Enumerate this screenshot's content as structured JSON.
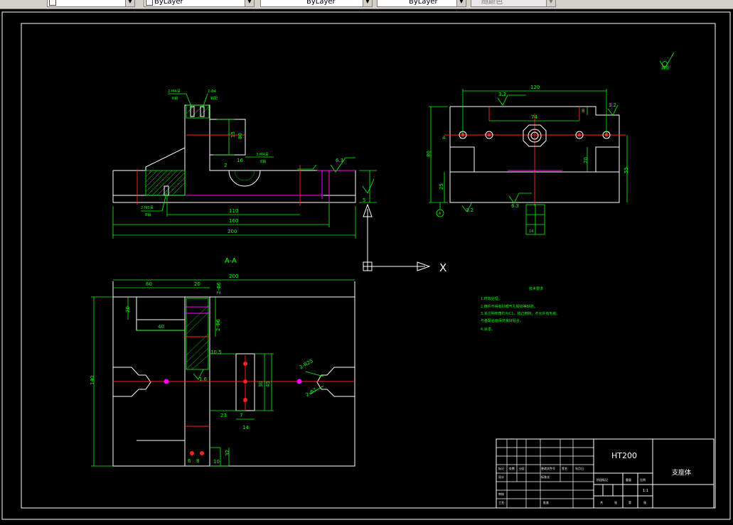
{
  "toolbar": {
    "layer_value": "",
    "color_value": "ByLayer",
    "linetype_value": "ByLayer",
    "lineweight_value": "ByLayer",
    "plotstyle_value": "随颜色"
  },
  "drawing": {
    "section_label": "A-A",
    "ucs_x_label": "X",
    "top_view_dims": {
      "d15": "15",
      "d80": "80",
      "d16": "16",
      "d2": "2",
      "d63": "6.3",
      "d110": "110",
      "d160": "160",
      "d200": "200",
      "d5": "5",
      "hole_note1": "2-M4深",
      "hole_note1b": "6销",
      "hole_note2": "2-Φ4",
      "hole_note2b": "销配",
      "hole_note3": "3-M4深",
      "hole_note3b": "6销",
      "hole_note4": "2-M5深",
      "hole_note4b": "8销"
    },
    "side_view_dims": {
      "d120": "120",
      "d74": "74",
      "d32a": "3.2",
      "d32b": "3.2",
      "d32c": "3.2",
      "d8": "8",
      "d80": "80",
      "d25": "25",
      "d20": "20",
      "d55": "55",
      "d63": "6.3",
      "d32": "32",
      "d14": "14",
      "a_label": "A"
    },
    "section_dims": {
      "d200": "200",
      "d60": "60",
      "d20": "20",
      "d246a": "2-Φ6",
      "d20b": "20",
      "d40": "40",
      "d246b": "2-Φ6",
      "d105": "10.5",
      "d140": "140",
      "d30": "30",
      "d45": "45",
      "d23": "23",
      "d7": "7",
      "d14": "14",
      "d32": "32",
      "d10": "10",
      "d6": "6",
      "d8": "8",
      "d16": "1.6",
      "r25": "2-R25",
      "phi7": "2-Φ7"
    },
    "roughness_note": "其余",
    "tech_req": {
      "title": "技术要求",
      "line1": "1.时效处理。",
      "line2": "2.铸件不得有砂眼气孔裂纹等缺陷。",
      "line3": "3.未注明倒角均为C1，锐边倒钝，不允许有毛刺。",
      "line3b": "与各配合面保持良好贴合。",
      "line4": "4.涂漆。"
    }
  },
  "title_block": {
    "material": "HT200",
    "part_name": "支座体",
    "scale_label": "1:1",
    "small_labels": [
      "标记",
      "处数",
      "分区",
      "更改文件号",
      "签名",
      "年月日",
      "设计",
      "标准化",
      "审核",
      "工艺",
      "批准",
      "阶段标记",
      "重量",
      "比例",
      "共",
      "张",
      "第",
      "张"
    ]
  }
}
